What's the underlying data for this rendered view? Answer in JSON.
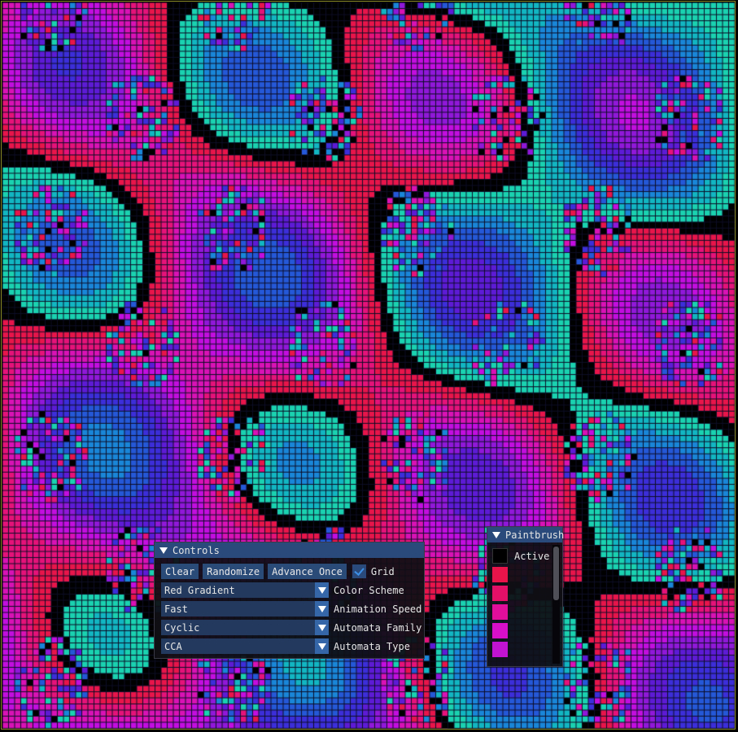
{
  "controls": {
    "title": "Controls",
    "buttons": {
      "clear": "Clear",
      "randomize": "Randomize",
      "advance": "Advance Once"
    },
    "grid_label": "Grid",
    "grid_checked": true,
    "combos": [
      {
        "value": "Red Gradient",
        "label": "Color Scheme"
      },
      {
        "value": "Fast",
        "label": "Animation Speed"
      },
      {
        "value": "Cyclic",
        "label": "Automata Family"
      },
      {
        "value": "CCA",
        "label": "Automata Type"
      }
    ]
  },
  "paintbrush": {
    "title": "Paintbrush",
    "active_label": "Active",
    "active_color": "#000000",
    "swatches": [
      "#e8144a",
      "#e21167",
      "#e00e9a",
      "#d70fc8",
      "#c213d2"
    ]
  },
  "grid": {
    "palette": [
      "#000000",
      "#e8154a",
      "#e5127a",
      "#d812b4",
      "#c30ee0",
      "#9018d8",
      "#5e1bd6",
      "#3c2ed8",
      "#2458d6",
      "#1a86d8",
      "#12b6c2",
      "#1ad2b0"
    ],
    "line_color": "#0d0d26"
  }
}
